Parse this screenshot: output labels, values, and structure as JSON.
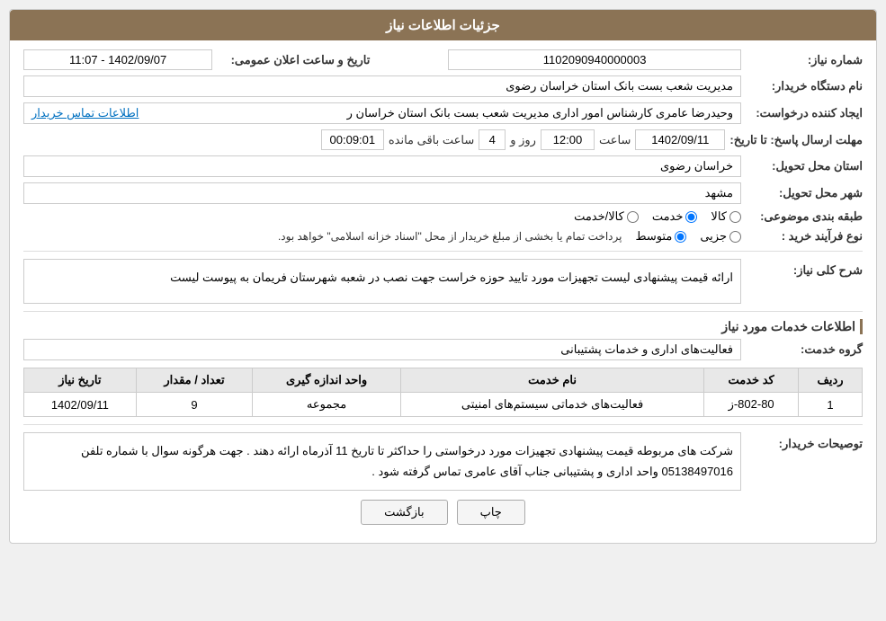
{
  "header": {
    "title": "جزئیات اطلاعات نیاز"
  },
  "fields": {
    "need_number_label": "شماره نیاز:",
    "need_number_value": "1102090940000003",
    "buyer_org_label": "نام دستگاه خریدار:",
    "buyer_org_value": "مدیریت شعب بست بانک استان خراسان رضوی",
    "creator_label": "ایجاد کننده درخواست:",
    "creator_value": "وحیدرضا عامری کارشناس امور اداری مدیریت شعب بست بانک استان خراسان ر",
    "creator_link": "اطلاعات تماس خریدار",
    "deadline_label": "مهلت ارسال پاسخ: تا تاریخ:",
    "deadline_date": "1402/09/11",
    "deadline_time_label": "ساعت",
    "deadline_time": "12:00",
    "deadline_days_label": "روز و",
    "deadline_days": "4",
    "deadline_remaining_label": "ساعت باقی مانده",
    "deadline_remaining": "00:09:01",
    "announce_label": "تاریخ و ساعت اعلان عمومی:",
    "announce_value": "1402/09/07 - 11:07",
    "province_label": "استان محل تحویل:",
    "province_value": "خراسان رضوی",
    "city_label": "شهر محل تحویل:",
    "city_value": "مشهد",
    "category_label": "طبقه بندی موضوعی:",
    "category_options": [
      "کالا",
      "خدمت",
      "کالا/خدمت"
    ],
    "category_selected": "خدمت",
    "purchase_type_label": "نوع فرآیند خرید :",
    "purchase_options": [
      "جزیی",
      "متوسط"
    ],
    "purchase_note": "پرداخت تمام یا بخشی از مبلغ خریدار از محل \"اسناد خزانه اسلامی\" خواهد بود.",
    "description_label": "شرح کلی نیاز:",
    "description_value": "ارائه قیمت پیشنهادی لیست تجهیزات مورد تایید حوزه خراست جهت نصب در شعبه شهرستان فریمان به پیوست لیست",
    "service_info_label": "اطلاعات خدمات مورد نیاز",
    "service_group_label": "گروه خدمت:",
    "service_group_value": "فعالیت‌های اداری و خدمات پشتیبانی",
    "table": {
      "headers": [
        "ردیف",
        "کد خدمت",
        "نام خدمت",
        "واحد اندازه گیری",
        "تعداد / مقدار",
        "تاریخ نیاز"
      ],
      "rows": [
        {
          "row": "1",
          "code": "802-80-ز",
          "name": "فعالیت‌های خدماتی سیستم‌های امنیتی",
          "unit": "مجموعه",
          "quantity": "9",
          "date": "1402/09/11"
        }
      ]
    },
    "buyer_notes_label": "توصیحات خریدار:",
    "buyer_notes_value": "شرکت های مربوطه قیمت پیشنهادی تجهیزات مورد درخواستی را حداکثر تا تاریخ 11 آذرماه ارائه دهند . جهت هرگونه سوال با شماره تلفن 05138497016 واحد اداری و پشتیبانی جناب آقای عامری تماس گرفته شود ."
  },
  "buttons": {
    "print_label": "چاپ",
    "back_label": "بازگشت"
  }
}
